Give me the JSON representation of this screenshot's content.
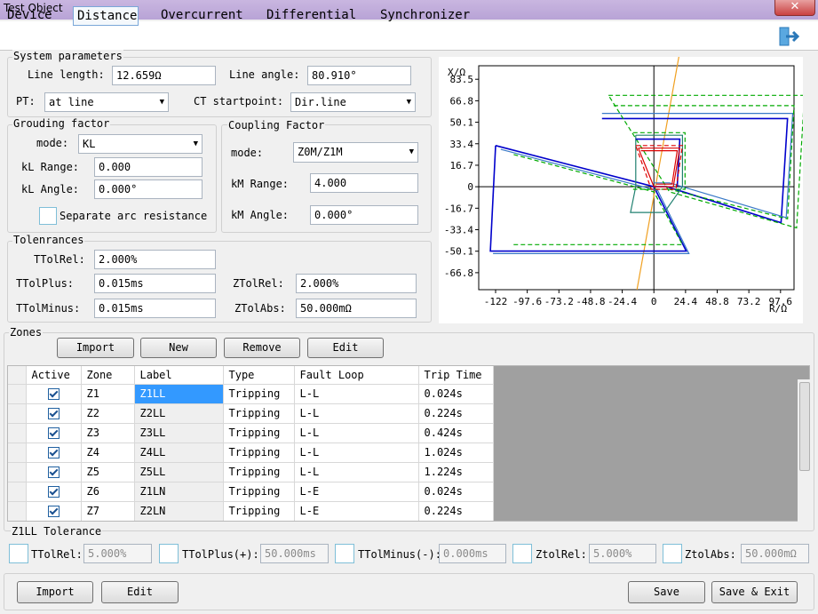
{
  "window": {
    "title": "Test Object",
    "close_glyph": "✕"
  },
  "tabs": [
    {
      "label": "Device"
    },
    {
      "label": "Distance",
      "active": true
    },
    {
      "label": "Overcurrent"
    },
    {
      "label": "Differential"
    },
    {
      "label": "Synchronizer"
    }
  ],
  "system": {
    "title": "System parameters",
    "line_length_label": "Line length:",
    "line_length_value": "12.659Ω",
    "line_angle_label": "Line angle:",
    "line_angle_value": "80.910°",
    "pt_label": "PT:",
    "pt_value": "at line",
    "ct_label": "CT startpoint:",
    "ct_value": "Dir.line"
  },
  "grounding": {
    "title": "Grouding factor",
    "mode_label": "mode:",
    "mode_value": "KL",
    "range_label": "kL Range:",
    "range_value": "0.000",
    "angle_label": "kL Angle:",
    "angle_value": "0.000°",
    "separate_label": "Separate arc resistance"
  },
  "coupling": {
    "title": "Coupling Factor",
    "mode_label": "mode:",
    "mode_value": "Z0M/Z1M",
    "range_label": "kM Range:",
    "range_value": "4.000",
    "angle_label": "kM Angle:",
    "angle_value": "0.000°"
  },
  "tolerances": {
    "title": "Tolenrances",
    "ttolrel_label": "TTolRel:",
    "ttolrel_value": "2.000%",
    "ttolplus_label": "TTolPlus:",
    "ttolplus_value": "0.015ms",
    "ttolminus_label": "TTolMinus:",
    "ttolminus_value": "0.015ms",
    "ztolrel_label": "ZTolRel:",
    "ztolrel_value": "2.000%",
    "ztolabs_label": "ZTolAbs:",
    "ztolabs_value": "50.000mΩ"
  },
  "zones": {
    "title": "Zones",
    "import_label": "Import",
    "new_label": "New",
    "remove_label": "Remove",
    "edit_label": "Edit",
    "columns": [
      "Active",
      "Zone",
      "Label",
      "Type",
      "Fault Loop",
      "Trip Time"
    ],
    "rows": [
      {
        "zone": "Z1",
        "label": "Z1LL",
        "type": "Tripping",
        "loop": "L-L",
        "time": "0.024s"
      },
      {
        "zone": "Z2",
        "label": "Z2LL",
        "type": "Tripping",
        "loop": "L-L",
        "time": "0.224s"
      },
      {
        "zone": "Z3",
        "label": "Z3LL",
        "type": "Tripping",
        "loop": "L-L",
        "time": "0.424s"
      },
      {
        "zone": "Z4",
        "label": "Z4LL",
        "type": "Tripping",
        "loop": "L-L",
        "time": "1.024s"
      },
      {
        "zone": "Z5",
        "label": "Z5LL",
        "type": "Tripping",
        "loop": "L-L",
        "time": "1.224s"
      },
      {
        "zone": "Z6",
        "label": "Z1LN",
        "type": "Tripping",
        "loop": "L-E",
        "time": "0.024s"
      },
      {
        "zone": "Z7",
        "label": "Z2LN",
        "type": "Tripping",
        "loop": "L-E",
        "time": "0.224s"
      }
    ]
  },
  "zone_tolerance": {
    "title": "Z1LL Tolerance",
    "ttolrel_label": "TTolRel:",
    "ttolrel_value": "5.000%",
    "ttolplus_label": "TTolPlus(+):",
    "ttolplus_value": "50.000ms",
    "ttolminus_label": "TTolMinus(-):",
    "ttolminus_value": "0.000ms",
    "ztolrel_label": "ZtolRel:",
    "ztolrel_value": "5.000%",
    "ztolabs_label": "ZtolAbs:",
    "ztolabs_value": "50.000mΩ"
  },
  "footer": {
    "import_label": "Import",
    "edit_label": "Edit",
    "save_label": "Save",
    "save_exit_label": "Save & Exit"
  },
  "icons": {
    "exit": "exit-door-icon"
  },
  "chart_data": {
    "type": "line",
    "xlabel": "R/Ω",
    "ylabel": "X/Ω",
    "xlim": [
      -135,
      108
    ],
    "ylim": [
      -80,
      94
    ],
    "x_ticks": [
      "-122",
      "-97.6",
      "-73.2",
      "-48.8",
      "-24.4",
      "0",
      "24.4",
      "48.8",
      "73.2",
      "97.6"
    ],
    "x_tick_values": [
      -122,
      -97.6,
      -73.2,
      -48.8,
      -24.4,
      0,
      24.4,
      48.8,
      73.2,
      97.6
    ],
    "y_ticks": [
      "83.5",
      "66.8",
      "50.1",
      "33.4",
      "16.7",
      "0",
      "-16.7",
      "-33.4",
      "-50.1",
      "-66.8"
    ],
    "y_tick_values": [
      83.5,
      66.8,
      50.1,
      33.4,
      16.7,
      0,
      -16.7,
      -33.4,
      -50.1,
      -66.8
    ],
    "grid": false,
    "colors": {
      "blue": "#0000cc",
      "green": "#00aa00",
      "teal": "#208070",
      "red": "#dd0000",
      "orange": "#f0a020"
    },
    "series": [
      {
        "color": "#f0a020",
        "style": "solid",
        "points": [
          [
            -13,
            -80
          ],
          [
            20,
            105
          ]
        ]
      },
      {
        "color": "#0000cc",
        "style": "solid",
        "points": [
          [
            -40,
            53
          ],
          [
            103,
            53
          ],
          [
            98,
            -28
          ],
          [
            10,
            0
          ],
          [
            0,
            0
          ]
        ]
      },
      {
        "color": "#3a7ac8",
        "style": "solid",
        "points": [
          [
            -40,
            57
          ],
          [
            107,
            57
          ],
          [
            102,
            -24
          ],
          [
            12,
            3
          ],
          [
            0,
            3
          ]
        ]
      },
      {
        "color": "#00aa00",
        "style": "dashed",
        "points": [
          [
            -35,
            71
          ],
          [
            116,
            71
          ],
          [
            110,
            -32
          ],
          [
            12,
            -4
          ],
          [
            -35,
            71
          ]
        ]
      },
      {
        "color": "#00aa00",
        "style": "dashed",
        "points": [
          [
            -31,
            63
          ],
          [
            108,
            63
          ],
          [
            103,
            -25
          ],
          [
            12,
            -2
          ]
        ]
      },
      {
        "color": "#0000cc",
        "style": "solid",
        "points": [
          [
            -122,
            32
          ],
          [
            0,
            0
          ],
          [
            25,
            -50
          ],
          [
            -126,
            -50
          ],
          [
            -122,
            32
          ]
        ]
      },
      {
        "color": "#3a7ac8",
        "style": "solid",
        "points": [
          [
            -118,
            29
          ],
          [
            3,
            -3
          ],
          [
            27,
            -52
          ],
          [
            -124,
            -52
          ]
        ]
      },
      {
        "color": "#00aa00",
        "style": "dashed",
        "points": [
          [
            -108,
            25
          ],
          [
            0,
            -4
          ],
          [
            22,
            -45
          ],
          [
            -110,
            -45
          ]
        ]
      },
      {
        "color": "#208070",
        "style": "solid",
        "points": [
          [
            -14,
            40
          ],
          [
            22,
            40
          ],
          [
            22,
            0
          ],
          [
            8,
            -20
          ],
          [
            -18,
            -20
          ],
          [
            -14,
            0
          ],
          [
            -14,
            40
          ]
        ]
      },
      {
        "color": "#00aa00",
        "style": "dashed",
        "points": [
          [
            -16,
            42
          ],
          [
            24,
            42
          ],
          [
            24,
            -2
          ],
          [
            -16,
            -2
          ]
        ]
      },
      {
        "color": "#0000cc",
        "style": "solid",
        "points": [
          [
            -14,
            37
          ],
          [
            20,
            37
          ],
          [
            18,
            0
          ]
        ]
      },
      {
        "color": "#dd0000",
        "style": "solid",
        "points": [
          [
            -12,
            30
          ],
          [
            20,
            30
          ],
          [
            15,
            0
          ],
          [
            0,
            0
          ],
          [
            -12,
            30
          ]
        ]
      },
      {
        "color": "#dd0000",
        "style": "dashed",
        "points": [
          [
            -14,
            32
          ],
          [
            22,
            32
          ],
          [
            17,
            -2
          ],
          [
            -2,
            -2
          ],
          [
            -14,
            32
          ]
        ]
      },
      {
        "color": "#dd0000",
        "style": "solid",
        "points": [
          [
            -10,
            28
          ],
          [
            18,
            28
          ],
          [
            14,
            2
          ],
          [
            2,
            2
          ]
        ]
      }
    ]
  }
}
